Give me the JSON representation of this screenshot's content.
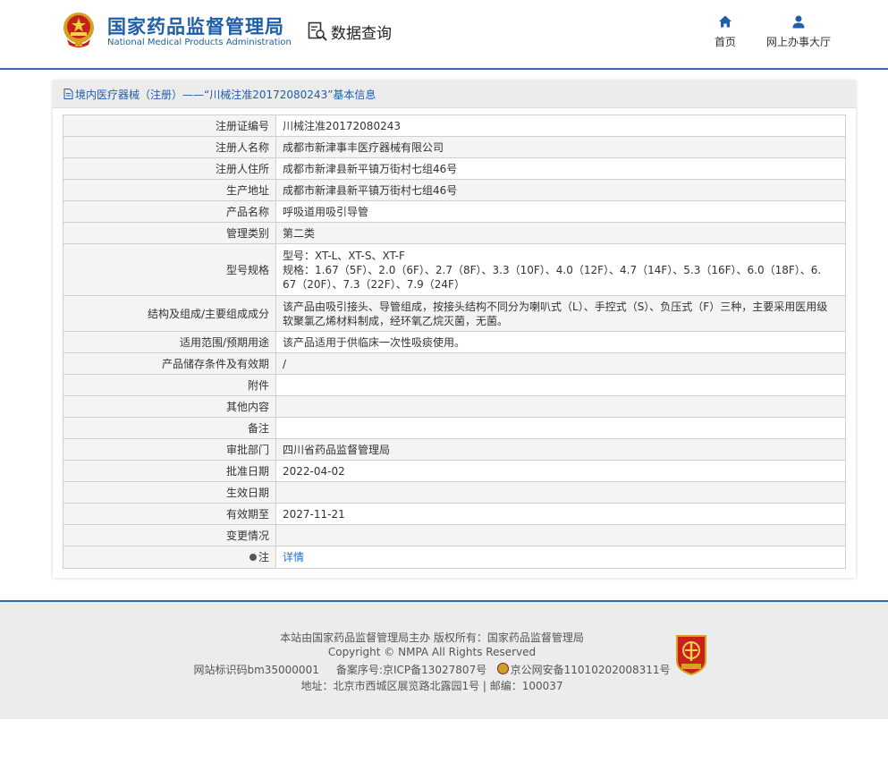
{
  "header": {
    "org_name_cn": "国家药品监督管理局",
    "org_name_en": "National Medical Products Administration",
    "query_label": "数据查询",
    "nav": [
      {
        "label": "首页",
        "icon": "home-icon"
      },
      {
        "label": "网上办事大厅",
        "icon": "user-icon"
      }
    ]
  },
  "panel": {
    "title": "境内医疗器械（注册）——“川械注准20172080243”基本信息"
  },
  "rows": [
    {
      "label": "注册证编号",
      "value": "川械注准20172080243"
    },
    {
      "label": "注册人名称",
      "value": "成都市新津事丰医疗器械有限公司"
    },
    {
      "label": "注册人住所",
      "value": "成都市新津县新平镇万街村七组46号"
    },
    {
      "label": "生产地址",
      "value": "成都市新津县新平镇万街村七组46号"
    },
    {
      "label": "产品名称",
      "value": "呼吸道用吸引导管"
    },
    {
      "label": "管理类别",
      "value": "第二类"
    },
    {
      "label": "型号规格",
      "value_lines": [
        "型号：XT-L、XT-S、XT-F",
        "规格：1.67（5F）、2.0（6F）、2.7（8F）、3.3（10F）、4.0（12F）、4.7（14F）、5.3（16F）、6.0（18F）、6.",
        "67（20F）、7.3（22F）、7.9（24F）"
      ]
    },
    {
      "label": "结构及组成/主要组成成分",
      "value_lines": [
        "该产品由吸引接头、导管组成，按接头结构不同分为喇叭式（L）、手控式（S）、负压式（F）三种，主要采用医用级",
        "软聚氯乙烯材料制成，经环氧乙烷灭菌，无菌。"
      ]
    },
    {
      "label": "适用范围/预期用途",
      "value": "该产品适用于供临床一次性吸痰使用。"
    },
    {
      "label": "产品储存条件及有效期",
      "value": "/"
    },
    {
      "label": "附件",
      "value": ""
    },
    {
      "label": "其他内容",
      "value": ""
    },
    {
      "label": "备注",
      "value": ""
    },
    {
      "label": "审批部门",
      "value": "四川省药品监督管理局"
    },
    {
      "label": "批准日期",
      "value": "2022-04-02"
    },
    {
      "label": "生效日期",
      "value": ""
    },
    {
      "label": "有效期至",
      "value": "2027-11-21"
    },
    {
      "label": "变更情况",
      "value": ""
    },
    {
      "label": "注",
      "value": "详情"
    }
  ],
  "footer": {
    "line1": "本站由国家药品监督管理局主办 版权所有：国家药品监督管理局",
    "line2": "Copyright © NMPA All Rights Reserved",
    "site_id": "网站标识码bm35000001",
    "icp": "备案序号:京ICP备13027807号",
    "police": "京公网安备11010202008311号",
    "address": "地址：北京市西城区展览路北露园1号 | 邮编：100037"
  }
}
